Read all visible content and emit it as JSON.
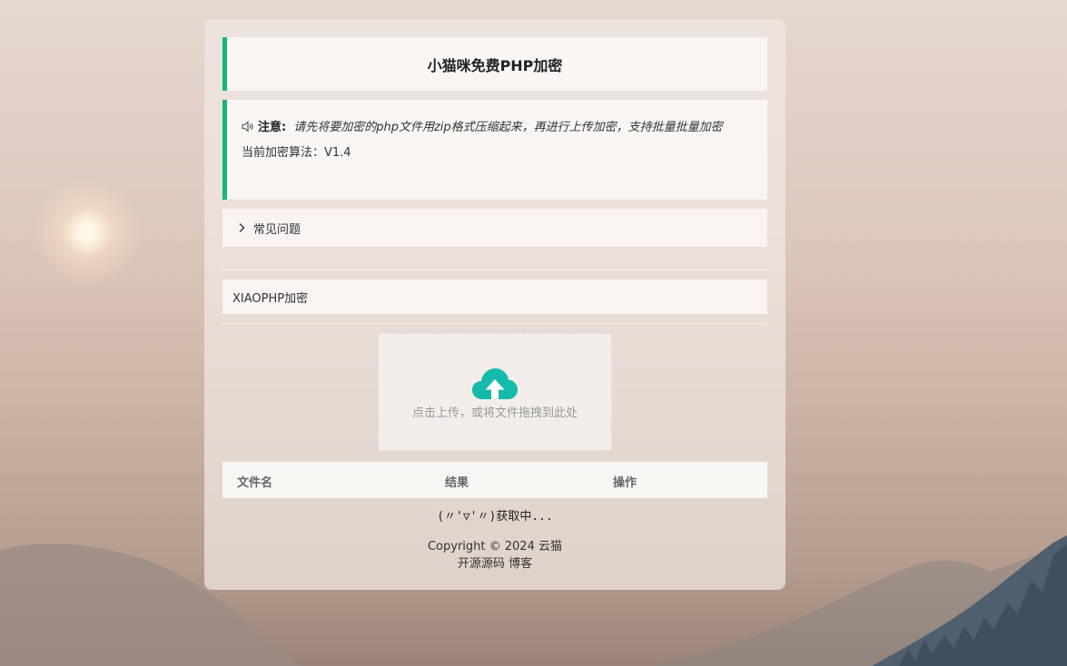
{
  "header": {
    "title": "小猫咪免费PHP加密"
  },
  "notice": {
    "label": "注意:",
    "text": "请先将要加密的php文件用zip格式压缩起来，再进行上传加密，支持批量批量加密",
    "version": "当前加密算法：V1.4"
  },
  "faq": {
    "label": "常见问题"
  },
  "section": {
    "name": "XIAOPHP加密"
  },
  "upload": {
    "hint": "点击上传，或将文件拖拽到此处"
  },
  "table": {
    "columns": [
      "文件名",
      "结果",
      "操作"
    ]
  },
  "status": {
    "fetching": "(〃'▽'〃)获取中..."
  },
  "footer": {
    "copyright": "Copyright © 2024 云猫",
    "links": [
      "开源源码",
      "博客"
    ]
  },
  "colors": {
    "accent": "#16b777",
    "cloud": "#16baaa"
  }
}
